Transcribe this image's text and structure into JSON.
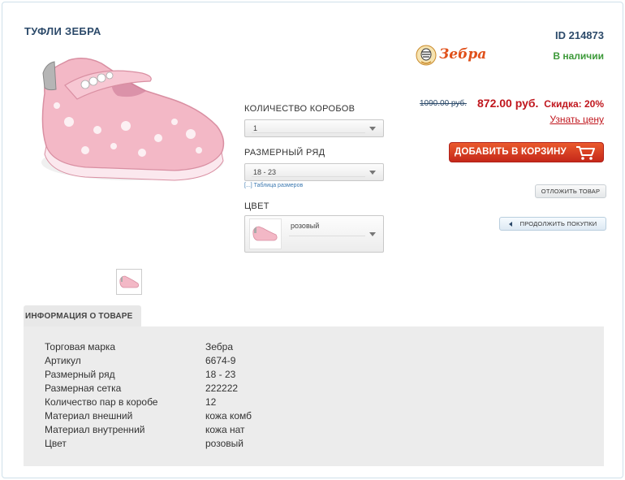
{
  "product": {
    "title": "ТУФЛИ ЗЕБРА",
    "id_label": "ID 214873",
    "brand_logo_text": "Зебра",
    "availability": "В наличии"
  },
  "options": {
    "boxes_label": "КОЛИЧЕСТВО КОРОБОВ",
    "boxes_value": "1",
    "size_range_label": "РАЗМЕРНЫЙ РЯД",
    "size_range_value": "18 - 23",
    "size_table_link": "[...] Таблица размеров",
    "color_label": "ЦВЕТ",
    "color_value": "розовый"
  },
  "pricing": {
    "old_price": "1090.00 руб.",
    "new_price": "872.00 руб.",
    "discount": "Скидка: 20%",
    "price_link": "Узнать цену"
  },
  "actions": {
    "add_to_cart": "ДОБАВИТЬ В КОРЗИНУ",
    "defer": "ОТЛОЖИТЬ ТОВАР",
    "continue_shopping": "ПРОДОЛЖИТЬ ПОКУПКИ"
  },
  "info": {
    "tab_label": "ИНФОРМАЦИЯ О ТОВАРЕ",
    "rows": [
      {
        "key": "Торговая марка",
        "value": "Зебра"
      },
      {
        "key": "Артикул",
        "value": "6674-9"
      },
      {
        "key": "Размерный ряд",
        "value": "18 - 23"
      },
      {
        "key": "Размерная сетка",
        "value": "222222"
      },
      {
        "key": "Количество пар в коробе",
        "value": "12"
      },
      {
        "key": "Материал внешний",
        "value": "кожа комб"
      },
      {
        "key": "Материал внутренний",
        "value": "кожа нат"
      },
      {
        "key": "Цвет",
        "value": "розовый"
      }
    ]
  },
  "colors": {
    "title": "#2c4a6a",
    "in_stock": "#3d9a3a",
    "price_red": "#c0161d",
    "cart_button": "#d53a22",
    "info_panel": "#ececec"
  }
}
